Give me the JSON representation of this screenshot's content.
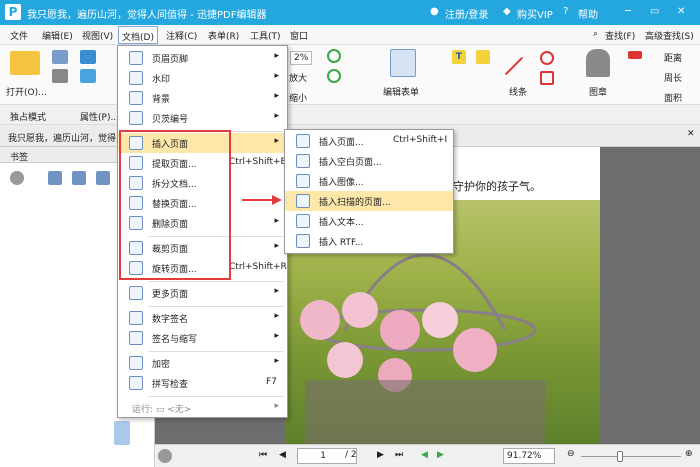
{
  "titlebar": {
    "title": "我只愿我，遍历山河，觉得人间值得 - 迅捷PDF编辑器",
    "login": "注册/登录",
    "vip": "购买VIP",
    "help": "帮助",
    "color": "#24a7df"
  },
  "menubar": {
    "items": [
      "文件",
      "编辑(E)",
      "视图(V)",
      "文档(D)",
      "注释(C)",
      "表单(R)",
      "工具(T)",
      "窗口"
    ],
    "find": "查找(F)",
    "advfind": "高级查找(S)"
  },
  "ribbon": {
    "open": "打开(O)...",
    "zoom": "2%",
    "enlarge": "放大",
    "shrink": "缩小",
    "edit_form": "编辑表单",
    "lines": "线条",
    "stamp": "图章",
    "distance": "距离",
    "perimeter": "周长",
    "area": "面积"
  },
  "row2": {
    "exclusive": "独占模式",
    "properties": "属性(P)..."
  },
  "tabline": {
    "tab": "我只愿我，遍历山河，觉得人..."
  },
  "sidebar": {
    "title": "书签"
  },
  "doc": {
    "text": "守护你的孩子气。"
  },
  "statusbar": {
    "page": "1",
    "total": "/ 2",
    "zoom": "91.72%"
  },
  "doc_menu": {
    "items": [
      {
        "label": "页眉页脚",
        "arrow": "▸"
      },
      {
        "label": "水印",
        "arrow": "▸"
      },
      {
        "label": "背景",
        "arrow": "▸"
      },
      {
        "label": "贝茨编号",
        "arrow": "▸"
      },
      {
        "label": "插入页面",
        "arrow": "▸"
      },
      {
        "label": "提取页面...",
        "shortcut": "Ctrl+Shift+E"
      },
      {
        "label": "拆分文档..."
      },
      {
        "label": "替换页面..."
      },
      {
        "label": "删除页面",
        "arrow": "▸"
      },
      {
        "label": "裁剪页面",
        "arrow": "▸"
      },
      {
        "label": "旋转页面...",
        "shortcut": "Ctrl+Shift+R"
      },
      {
        "label": "更多页面",
        "arrow": "▸"
      },
      {
        "label": "数字签名",
        "arrow": "▸"
      },
      {
        "label": "签名与缩写",
        "arrow": "▸"
      },
      {
        "label": "加密",
        "arrow": "▸"
      },
      {
        "label": "拼写检查",
        "shortcut": "F7"
      },
      {
        "label": "运行: ▭ <无>",
        "arrow": "▸"
      }
    ]
  },
  "insert_submenu": {
    "items": [
      {
        "label": "插入页面...",
        "shortcut": "Ctrl+Shift+I"
      },
      {
        "label": "插入空白页面..."
      },
      {
        "label": "插入图像..."
      },
      {
        "label": "插入扫描的页面..."
      },
      {
        "label": "插入文本..."
      },
      {
        "label": "插入 RTF..."
      }
    ]
  }
}
